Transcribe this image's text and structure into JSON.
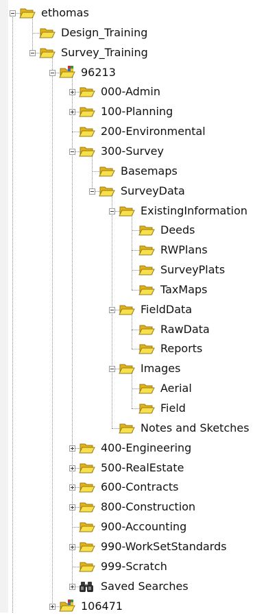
{
  "colors": {
    "folder_fill": "#f6e04c",
    "folder_back": "#e2b21d",
    "folder_edge": "#9c7a10"
  },
  "tree": [
    {
      "label": "ethomas",
      "depth": 0,
      "toggle": "minus",
      "icon": "folder-open-icon"
    },
    {
      "label": "Design_Training",
      "depth": 1,
      "toggle": "none",
      "icon": "folder-open-icon"
    },
    {
      "label": "Survey_Training",
      "depth": 1,
      "toggle": "minus",
      "icon": "folder-open-icon"
    },
    {
      "label": "96213",
      "depth": 2,
      "toggle": "minus",
      "icon": "project-folder-icon"
    },
    {
      "label": "000-Admin",
      "depth": 3,
      "toggle": "plus",
      "icon": "folder-open-icon"
    },
    {
      "label": "100-Planning",
      "depth": 3,
      "toggle": "plus",
      "icon": "folder-open-icon"
    },
    {
      "label": "200-Environmental",
      "depth": 3,
      "toggle": "none",
      "icon": "folder-open-icon"
    },
    {
      "label": "300-Survey",
      "depth": 3,
      "toggle": "minus",
      "icon": "folder-open-icon"
    },
    {
      "label": "Basemaps",
      "depth": 4,
      "toggle": "none",
      "icon": "folder-open-icon"
    },
    {
      "label": "SurveyData",
      "depth": 4,
      "toggle": "minus",
      "icon": "folder-open-icon"
    },
    {
      "label": "ExistingInformation",
      "depth": 5,
      "toggle": "minus",
      "icon": "folder-open-icon"
    },
    {
      "label": "Deeds",
      "depth": 6,
      "toggle": "none",
      "icon": "folder-open-icon"
    },
    {
      "label": "RWPlans",
      "depth": 6,
      "toggle": "none",
      "icon": "folder-open-icon"
    },
    {
      "label": "SurveyPlats",
      "depth": 6,
      "toggle": "none",
      "icon": "folder-open-icon"
    },
    {
      "label": "TaxMaps",
      "depth": 6,
      "toggle": "none",
      "icon": "folder-open-icon"
    },
    {
      "label": "FieldData",
      "depth": 5,
      "toggle": "minus",
      "icon": "folder-open-icon"
    },
    {
      "label": "RawData",
      "depth": 6,
      "toggle": "none",
      "icon": "folder-open-icon"
    },
    {
      "label": "Reports",
      "depth": 6,
      "toggle": "none",
      "icon": "folder-open-icon"
    },
    {
      "label": "Images",
      "depth": 5,
      "toggle": "minus",
      "icon": "folder-open-icon"
    },
    {
      "label": "Aerial",
      "depth": 6,
      "toggle": "none",
      "icon": "folder-open-icon"
    },
    {
      "label": "Field",
      "depth": 6,
      "toggle": "none",
      "icon": "folder-open-icon"
    },
    {
      "label": "Notes and Sketches",
      "depth": 5,
      "toggle": "none",
      "icon": "folder-open-icon"
    },
    {
      "label": "400-Engineering",
      "depth": 3,
      "toggle": "plus",
      "icon": "folder-open-icon"
    },
    {
      "label": "500-RealEstate",
      "depth": 3,
      "toggle": "plus",
      "icon": "folder-open-icon"
    },
    {
      "label": "600-Contracts",
      "depth": 3,
      "toggle": "plus",
      "icon": "folder-open-icon"
    },
    {
      "label": "800-Construction",
      "depth": 3,
      "toggle": "plus",
      "icon": "folder-open-icon"
    },
    {
      "label": "900-Accounting",
      "depth": 3,
      "toggle": "none",
      "icon": "folder-open-icon"
    },
    {
      "label": "990-WorkSetStandards",
      "depth": 3,
      "toggle": "plus",
      "icon": "folder-open-icon"
    },
    {
      "label": "999-Scratch",
      "depth": 3,
      "toggle": "none",
      "icon": "folder-open-icon"
    },
    {
      "label": "Saved Searches",
      "depth": 3,
      "toggle": "plus",
      "icon": "binoculars-icon"
    },
    {
      "label": "106471",
      "depth": 2,
      "toggle": "plus",
      "icon": "project-folder-icon"
    }
  ]
}
